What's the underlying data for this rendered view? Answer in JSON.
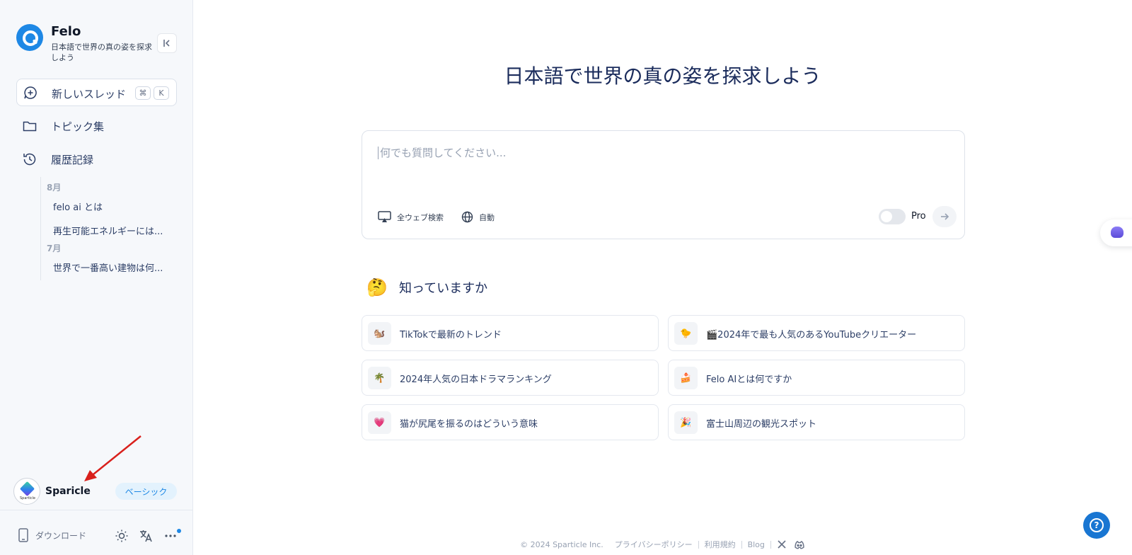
{
  "sidebar": {
    "brand_name": "Felo",
    "brand_tagline": "日本語で世界の真の姿を探求しよう",
    "new_thread": {
      "label": "新しいスレッド",
      "kbd_cmd": "⌘",
      "kbd_key": "K"
    },
    "nav": [
      {
        "label": "トピック集",
        "icon": "folder-icon"
      },
      {
        "label": "履歴記録",
        "icon": "history-icon"
      }
    ],
    "history": [
      {
        "month": "8月",
        "items": [
          "felo ai とは",
          "再生可能エネルギーには..."
        ]
      },
      {
        "month": "7月",
        "items": [
          "世界で一番高い建物は何..."
        ]
      }
    ],
    "account": {
      "name": "Sparicle",
      "avatar_text": "Sparticle",
      "plan": "ベーシック"
    },
    "footer": {
      "download_label": "ダウンロード"
    }
  },
  "main": {
    "hero_title": "日本語で世界の真の姿を探求しよう",
    "search": {
      "placeholder": "何でも質問してください...",
      "option_web": "全ウェブ検索",
      "option_auto": "自動",
      "pro_label": "Pro"
    },
    "did_you_know": {
      "emoji": "🤔",
      "title": "知っていますか",
      "cards": [
        {
          "emoji": "🐿️",
          "text": "TikTokで最新のトレンド"
        },
        {
          "emoji": "🐤",
          "text": "🎬2024年で最も人気のあるYouTubeクリエーター"
        },
        {
          "emoji": "🌴",
          "text": "2024年人気の日本ドラマランキング"
        },
        {
          "emoji": "🍰",
          "text": "Felo AIとは何ですか"
        },
        {
          "emoji": "💗",
          "text": "猫が尻尾を振るのはどういう意味"
        },
        {
          "emoji": "🎉",
          "text": "富士山周辺の観光スポット"
        }
      ]
    }
  },
  "footer": {
    "copyright": "© 2024 Sparticle Inc.",
    "privacy": "プライバシーポリシー",
    "terms": "利用規約",
    "blog": "Blog"
  },
  "colors": {
    "accent": "#1e88e5",
    "title": "#1b2c5c",
    "arrow": "#d9201c"
  }
}
